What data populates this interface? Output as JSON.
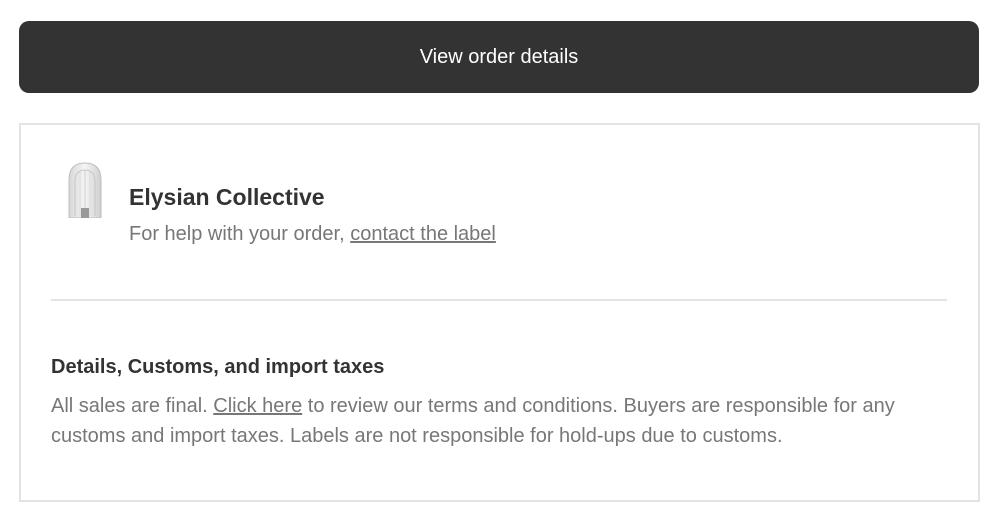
{
  "order_button": {
    "label": "View order details"
  },
  "store": {
    "name": "Elysian Collective",
    "help_prefix": "For help with your order, ",
    "help_link": "contact the label"
  },
  "policy": {
    "heading": "Details, Customs, and import taxes",
    "text_before": "All sales are final. ",
    "link": "Click here",
    "text_after": " to review our terms and conditions. Buyers are responsible for any customs and import taxes. Labels are not responsible for hold-ups due to customs."
  },
  "colors": {
    "button_background": "#333333",
    "button_text": "#ffffff",
    "heading_text": "#333333",
    "body_text": "#777777",
    "border": "#e3e3e3"
  },
  "icons": {
    "store_logo": "arched-window-logo"
  }
}
